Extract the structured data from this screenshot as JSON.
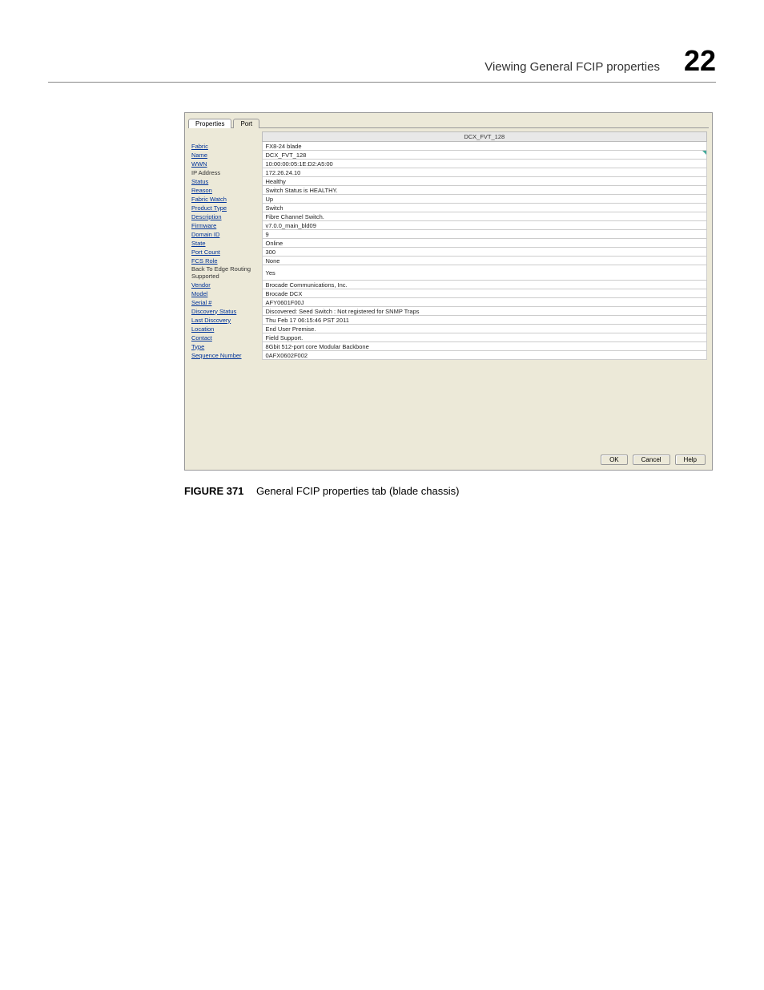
{
  "header": {
    "title": "Viewing General FCIP properties",
    "chapter": "22"
  },
  "dialog": {
    "tabs": [
      {
        "label": "Properties",
        "active": true
      },
      {
        "label": "Port",
        "active": false
      }
    ],
    "columnHeader": "DCX_FVT_128",
    "rows": [
      {
        "label": "Fabric",
        "value": "FX8-24 blade",
        "link": true
      },
      {
        "label": "Name",
        "value": "DCX_FVT_128",
        "link": true,
        "editable": true
      },
      {
        "label": "WWN",
        "value": "10:00:00:05:1E:D2:A5:00",
        "link": true
      },
      {
        "label": "IP Address",
        "value": "172.26.24.10",
        "link": false
      },
      {
        "label": "Status",
        "value": "Healthy",
        "link": true
      },
      {
        "label": "Reason",
        "value": "Switch Status is HEALTHY.",
        "link": true
      },
      {
        "label": "Fabric Watch",
        "value": "Up",
        "link": true
      },
      {
        "label": "Product Type",
        "value": "Switch",
        "link": true
      },
      {
        "label": "Description",
        "value": "Fibre Channel Switch.",
        "link": true
      },
      {
        "label": "Firmware",
        "value": "v7.0.0_main_bld09",
        "link": true
      },
      {
        "label": "Domain ID",
        "value": "9",
        "link": true
      },
      {
        "label": "State",
        "value": "Online",
        "link": true
      },
      {
        "label": "Port Count",
        "value": "300",
        "link": true
      },
      {
        "label": "FCS Role",
        "value": "None",
        "link": true
      },
      {
        "label": "Back To Edge Routing Supported",
        "value": "Yes",
        "link": false
      },
      {
        "label": "Vendor",
        "value": "Brocade Communications, Inc.",
        "link": true
      },
      {
        "label": "Model",
        "value": "Brocade DCX",
        "link": true
      },
      {
        "label": "Serial #",
        "value": "AFY0601F00J",
        "link": true
      },
      {
        "label": "Discovery Status",
        "value": "Discovered: Seed Switch : Not registered for SNMP Traps",
        "link": true
      },
      {
        "label": "Last Discovery",
        "value": "Thu Feb 17 06:15:46 PST 2011",
        "link": true
      },
      {
        "label": "Location",
        "value": "End User Premise.",
        "link": true
      },
      {
        "label": "Contact",
        "value": "Field Support.",
        "link": true
      },
      {
        "label": "Type",
        "value": "8Gbit 512-port core Modular Backbone",
        "link": true
      },
      {
        "label": "Sequence Number",
        "value": "0AFX0602F002",
        "link": true
      }
    ],
    "buttons": {
      "ok": "OK",
      "cancel": "Cancel",
      "help": "Help"
    }
  },
  "figure": {
    "label": "FIGURE 371",
    "caption": "General FCIP properties tab (blade chassis)"
  }
}
